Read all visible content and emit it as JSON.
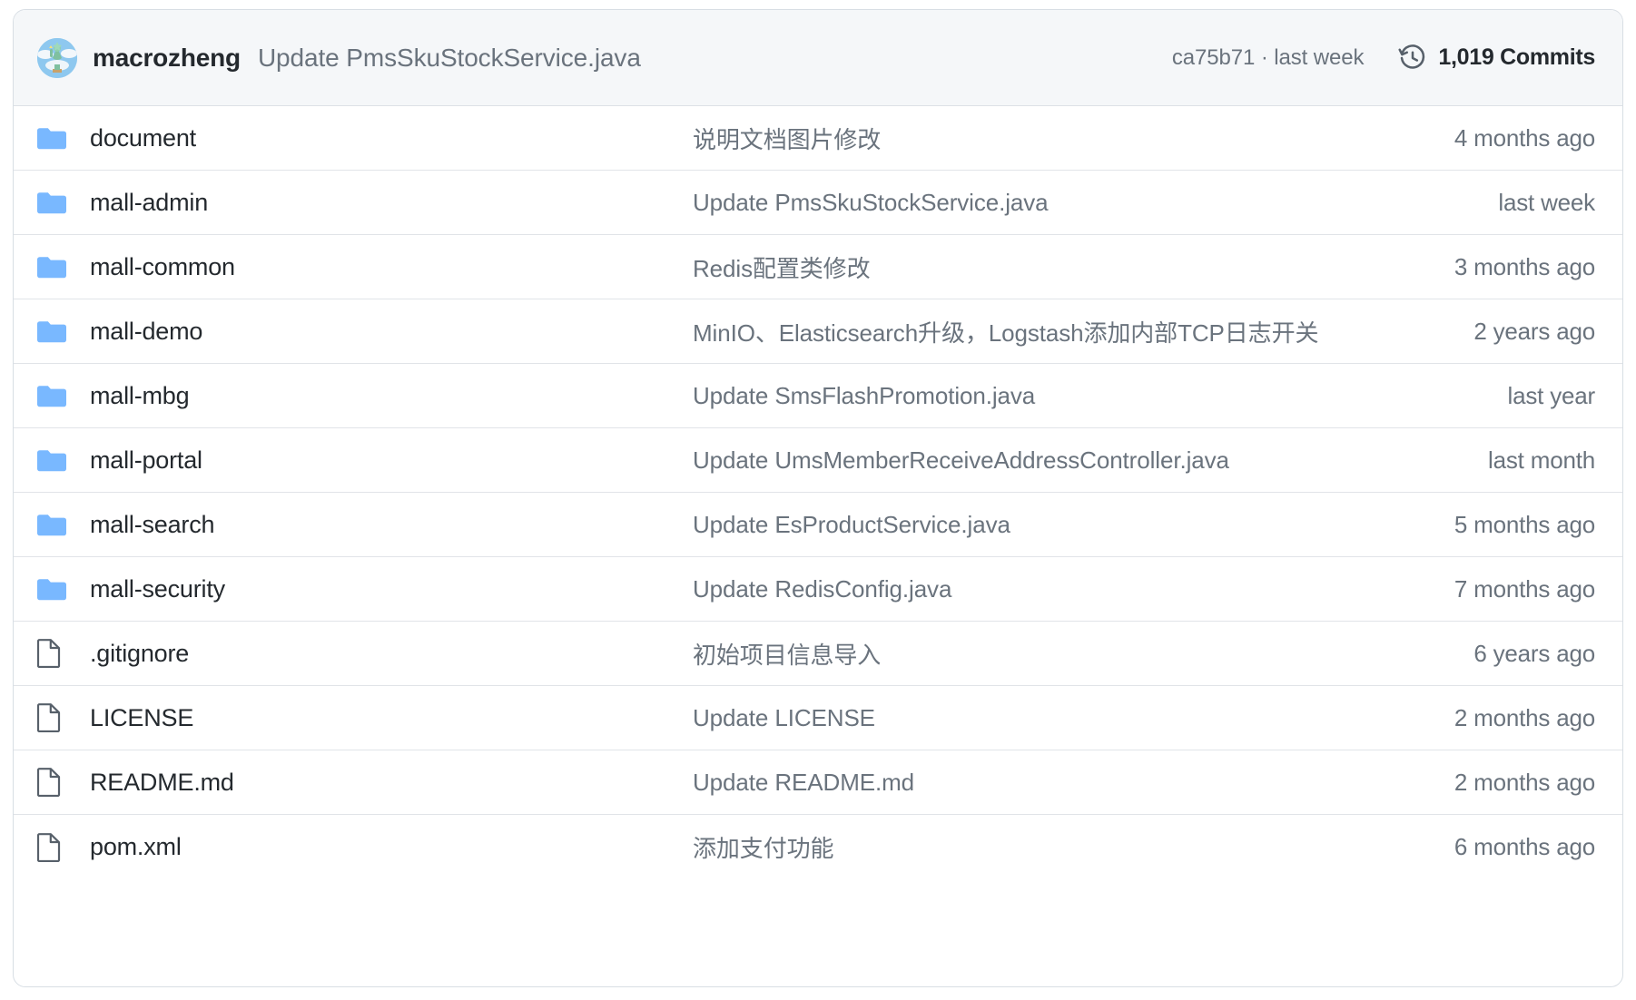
{
  "header": {
    "avatar_name": "macrozheng-avatar",
    "author": "macrozheng",
    "commit_message": "Update PmsSkuStockService.java",
    "commit_meta": "ca75b71 · last week",
    "history_icon": "history-clock-icon",
    "commits_label": "1,019 Commits"
  },
  "colors": {
    "header_background": "#f5f7f9",
    "row_background": "#ffffff",
    "border": "#e1e4e8",
    "folder_icon": "#79b8ff",
    "file_icon": "#57606a",
    "primary_text": "#24292e",
    "muted_text": "#6a737d"
  },
  "rows": [
    {
      "icon": "folder-icon",
      "type": "folder",
      "name": "document",
      "message": "说明文档图片修改",
      "time": "4 months ago"
    },
    {
      "icon": "folder-icon",
      "type": "folder",
      "name": "mall-admin",
      "message": "Update PmsSkuStockService.java",
      "time": "last week"
    },
    {
      "icon": "folder-icon",
      "type": "folder",
      "name": "mall-common",
      "message": "Redis配置类修改",
      "time": "3 months ago"
    },
    {
      "icon": "folder-icon",
      "type": "folder",
      "name": "mall-demo",
      "message": "MinIO、Elasticsearch升级，Logstash添加内部TCP日志开关",
      "time": "2 years ago"
    },
    {
      "icon": "folder-icon",
      "type": "folder",
      "name": "mall-mbg",
      "message": "Update SmsFlashPromotion.java",
      "time": "last year"
    },
    {
      "icon": "folder-icon",
      "type": "folder",
      "name": "mall-portal",
      "message": "Update UmsMemberReceiveAddressController.java",
      "time": "last month"
    },
    {
      "icon": "folder-icon",
      "type": "folder",
      "name": "mall-search",
      "message": "Update EsProductService.java",
      "time": "5 months ago"
    },
    {
      "icon": "folder-icon",
      "type": "folder",
      "name": "mall-security",
      "message": "Update RedisConfig.java",
      "time": "7 months ago"
    },
    {
      "icon": "file-icon",
      "type": "file",
      "name": ".gitignore",
      "message": "初始项目信息导入",
      "time": "6 years ago"
    },
    {
      "icon": "file-icon",
      "type": "file",
      "name": "LICENSE",
      "message": "Update LICENSE",
      "time": "2 months ago"
    },
    {
      "icon": "file-icon",
      "type": "file",
      "name": "README.md",
      "message": "Update README.md",
      "time": "2 months ago"
    },
    {
      "icon": "file-icon",
      "type": "file",
      "name": "pom.xml",
      "message": "添加支付功能",
      "time": "6 months ago"
    }
  ]
}
